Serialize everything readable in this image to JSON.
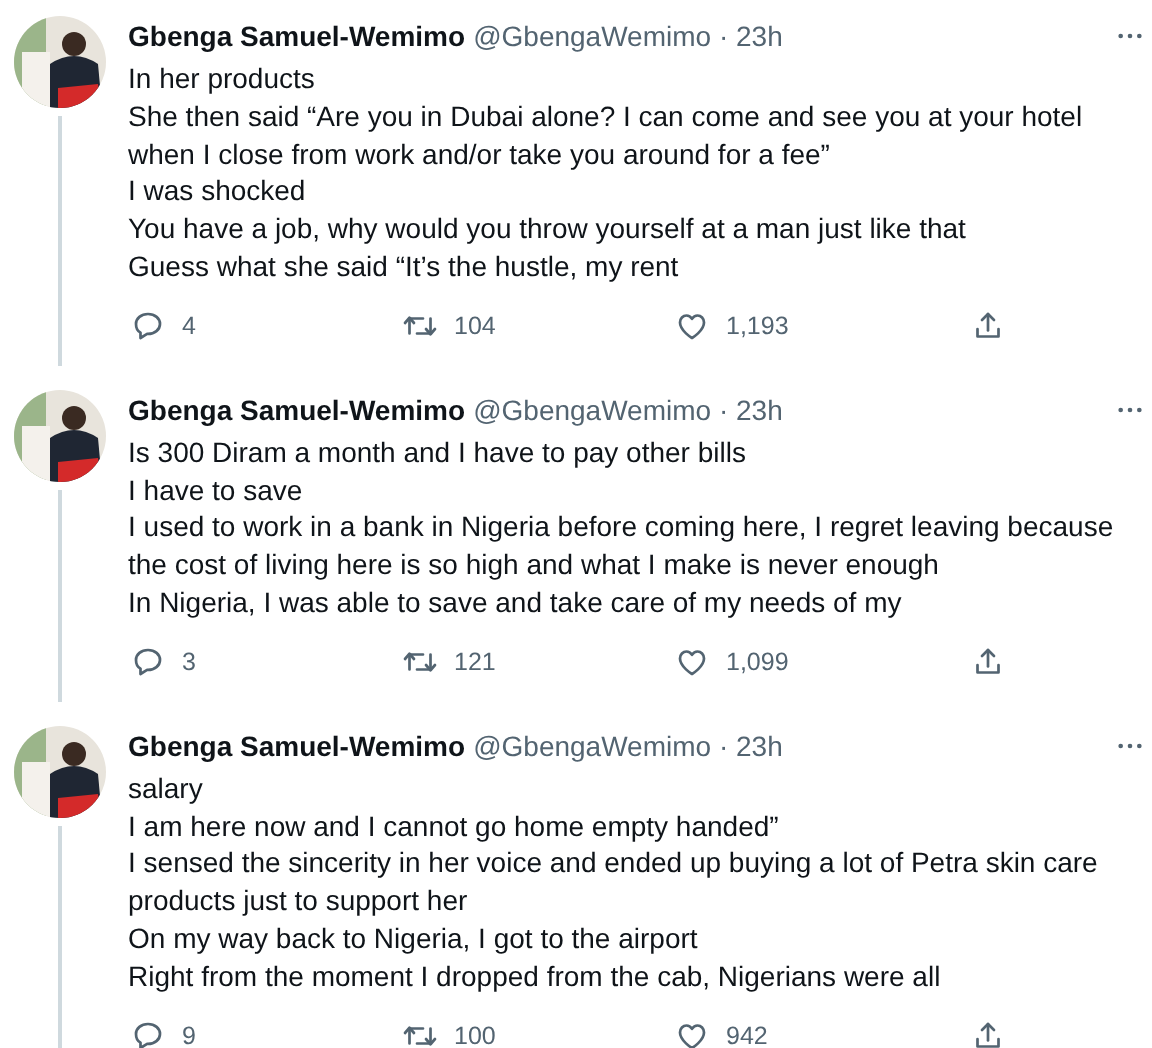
{
  "tweets": [
    {
      "name": "Gbenga Samuel-Wemimo",
      "meta": "@GbengaWemimo · 23h",
      "lines": [
        "In her products",
        "She then said “Are you in Dubai alone? I can come and see you at your hotel when I close from work and/or take you around for a fee”",
        "I was shocked",
        "You have a job, why would you throw yourself at a man just like that",
        "Guess what she said “It’s the hustle, my rent"
      ],
      "replies": "4",
      "retweets": "104",
      "likes": "1,193"
    },
    {
      "name": "Gbenga Samuel-Wemimo",
      "meta": "@GbengaWemimo · 23h",
      "lines": [
        "Is 300 Diram a month and I have to pay other bills",
        "I have to save",
        "I used to work in a bank in Nigeria before coming here, I regret leaving because the cost of living here is so high and what I make is never enough",
        "In Nigeria, I was able to save and take care of my needs of my"
      ],
      "replies": "3",
      "retweets": "121",
      "likes": "1,099"
    },
    {
      "name": "Gbenga Samuel-Wemimo",
      "meta": "@GbengaWemimo · 23h",
      "lines": [
        "salary",
        "I am here now and I cannot go home empty handed”",
        "I sensed the sincerity in her voice and ended up buying a lot of Petra skin care products just to support her",
        "On my way back to Nigeria, I got to the airport",
        "Right from the moment I dropped from the cab, Nigerians were all"
      ],
      "replies": "9",
      "retweets": "100",
      "likes": "942"
    }
  ]
}
